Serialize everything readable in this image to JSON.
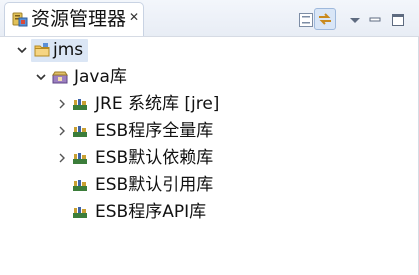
{
  "view": {
    "tab_title": "资源管理器",
    "tab_icon": "package-explorer-icon",
    "close_glyph": "✕"
  },
  "toolbar": {
    "collapse_all": "collapse-all-icon",
    "link_with_editor": "link-with-editor-icon",
    "view_menu": "view-menu-icon",
    "minimize": "minimize-icon",
    "maximize": "maximize-icon"
  },
  "tree": {
    "project": {
      "label": "jms",
      "expanded": true,
      "selected": true
    },
    "java_lib": {
      "label": "Java库",
      "expanded": true
    },
    "libraries": [
      {
        "label": "JRE 系统库 [jre]",
        "expandable": true
      },
      {
        "label": "ESB程序全量库",
        "expandable": true
      },
      {
        "label": "ESB默认依赖库",
        "expandable": true
      },
      {
        "label": "ESB默认引用库",
        "expandable": false
      },
      {
        "label": "ESB程序API库",
        "expandable": false
      }
    ]
  },
  "colors": {
    "selection": "#dbe6f5",
    "header_bg": "#eaeff6",
    "folder": "#e9b84a",
    "library_book": "#3b7d3a"
  }
}
